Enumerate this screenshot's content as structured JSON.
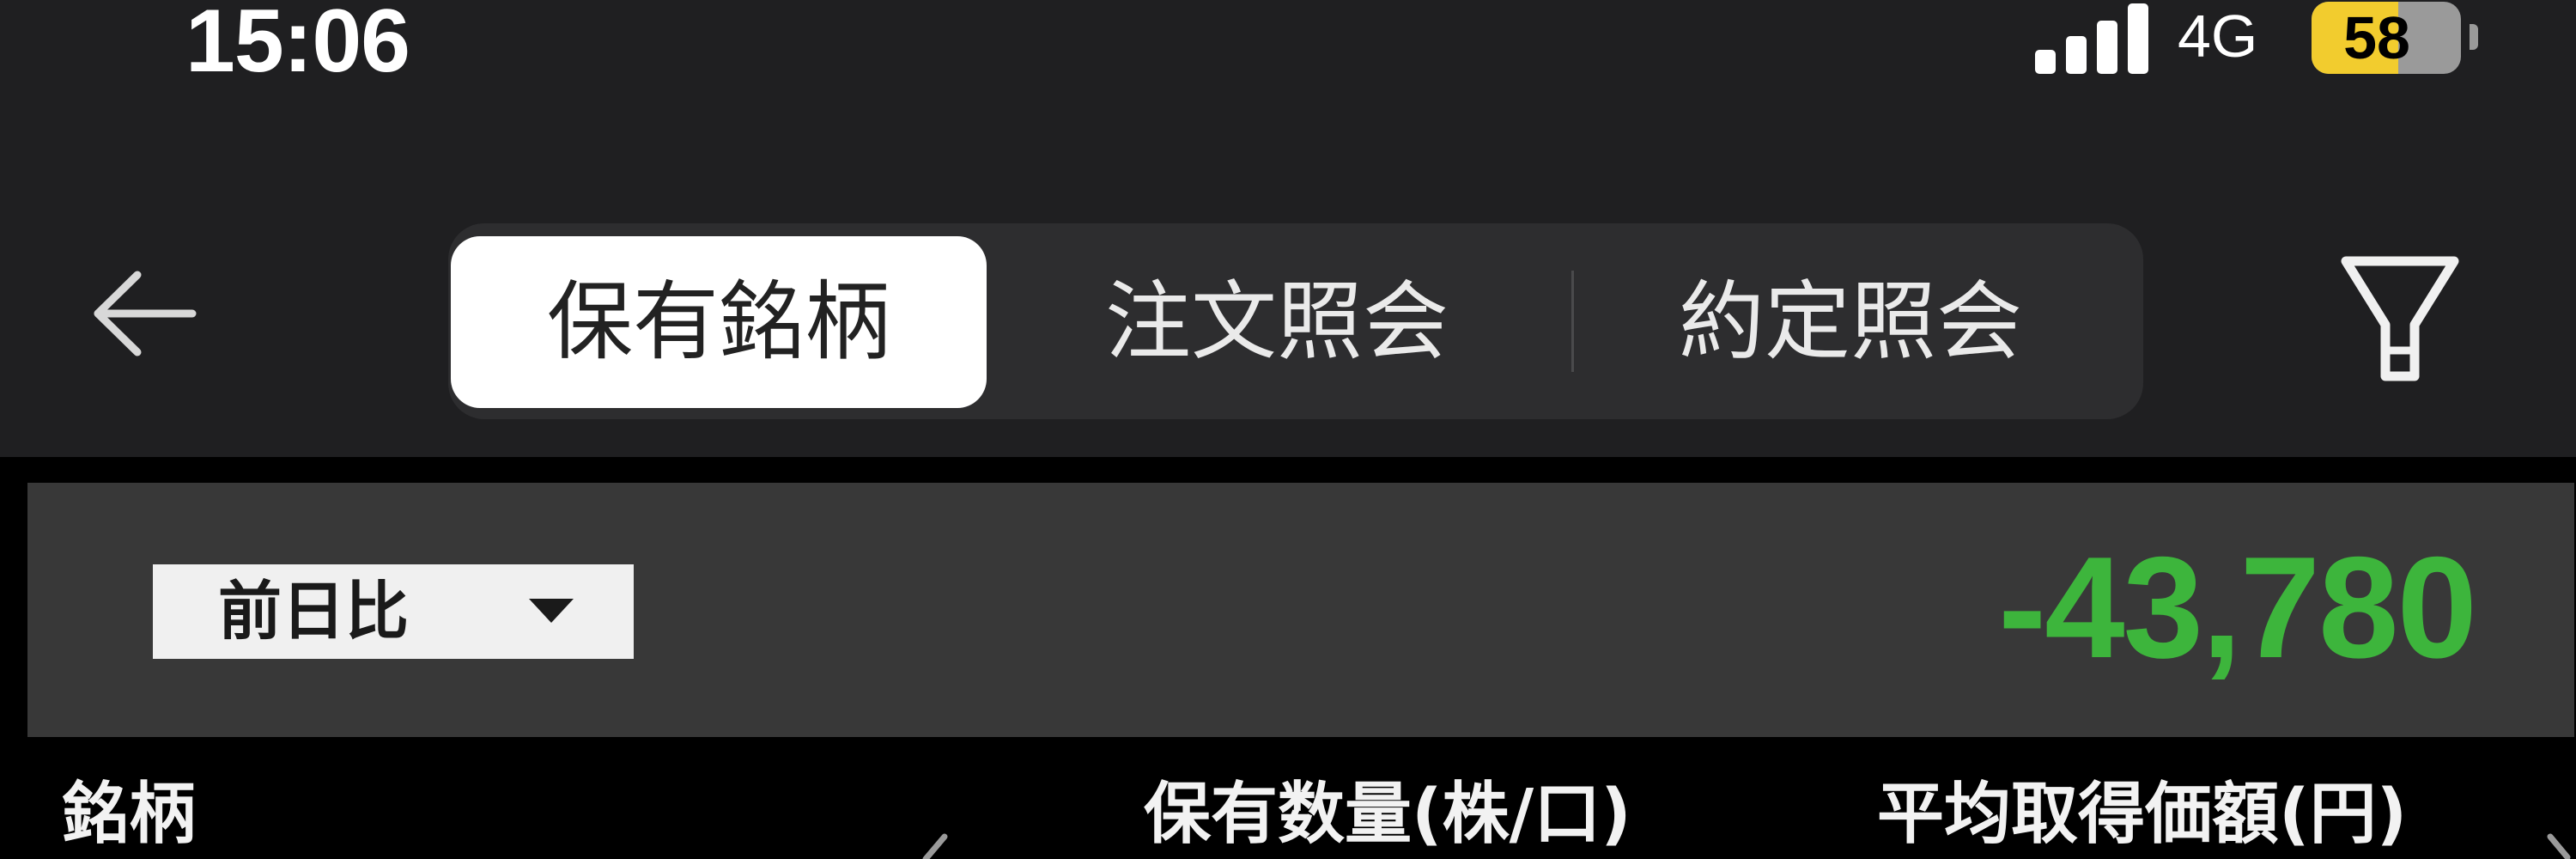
{
  "status_bar": {
    "time": "15:06",
    "network": "4G",
    "battery": "58",
    "battery_level": 0.58
  },
  "nav": {
    "back_icon": "arrow-left-icon",
    "tabs": [
      {
        "label": "保有銘柄",
        "active": true
      },
      {
        "label": "注文照会",
        "active": false
      },
      {
        "label": "約定照会",
        "active": false
      }
    ],
    "filter_icon": "filter-icon"
  },
  "summary": {
    "dropdown_label": "前日比",
    "dropdown_icon": "caret-down-icon",
    "value": "-43,780",
    "value_color": "#3db53c"
  },
  "table": {
    "columns": [
      "銘柄",
      "保有数量(株/口)",
      "平均取得価額(円)"
    ],
    "scroll_icons": [
      "chevron-left-icon",
      "chevron-right-icon"
    ]
  },
  "colors": {
    "background": "#1f1f21",
    "panel": "#383838",
    "active_tab": "#ffffff",
    "battery": "#f2cc2e"
  }
}
